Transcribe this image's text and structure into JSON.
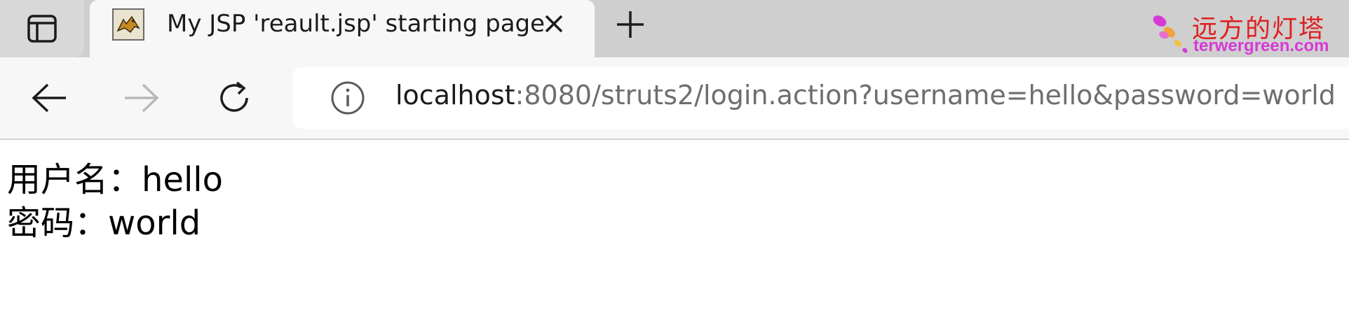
{
  "browser": {
    "tab": {
      "title": "My JSP 'reault.jsp' starting page",
      "favicon": "tomcat-icon"
    },
    "address_bar": {
      "host": "localhost",
      "path": ":8080/struts2/login.action?username=hello&password=world"
    },
    "icons": {
      "tab_actions": "tab-actions-icon",
      "close": "close-icon",
      "new_tab": "plus-icon",
      "back": "back-arrow-icon",
      "forward": "forward-arrow-icon",
      "refresh": "refresh-icon",
      "site_info": "info-icon"
    }
  },
  "page": {
    "lines": [
      {
        "label": "用户名：",
        "value": "hello"
      },
      {
        "label": "密码：",
        "value": "world"
      }
    ]
  },
  "watermark": {
    "title": "远方的灯塔",
    "subtitle": "terwergreen.com"
  },
  "colors": {
    "tabbar_bg": "#cfcfcf",
    "toolbar_bg": "#f7f7f7",
    "watermark_red": "#e02020",
    "watermark_magenta": "#d63ad6"
  }
}
